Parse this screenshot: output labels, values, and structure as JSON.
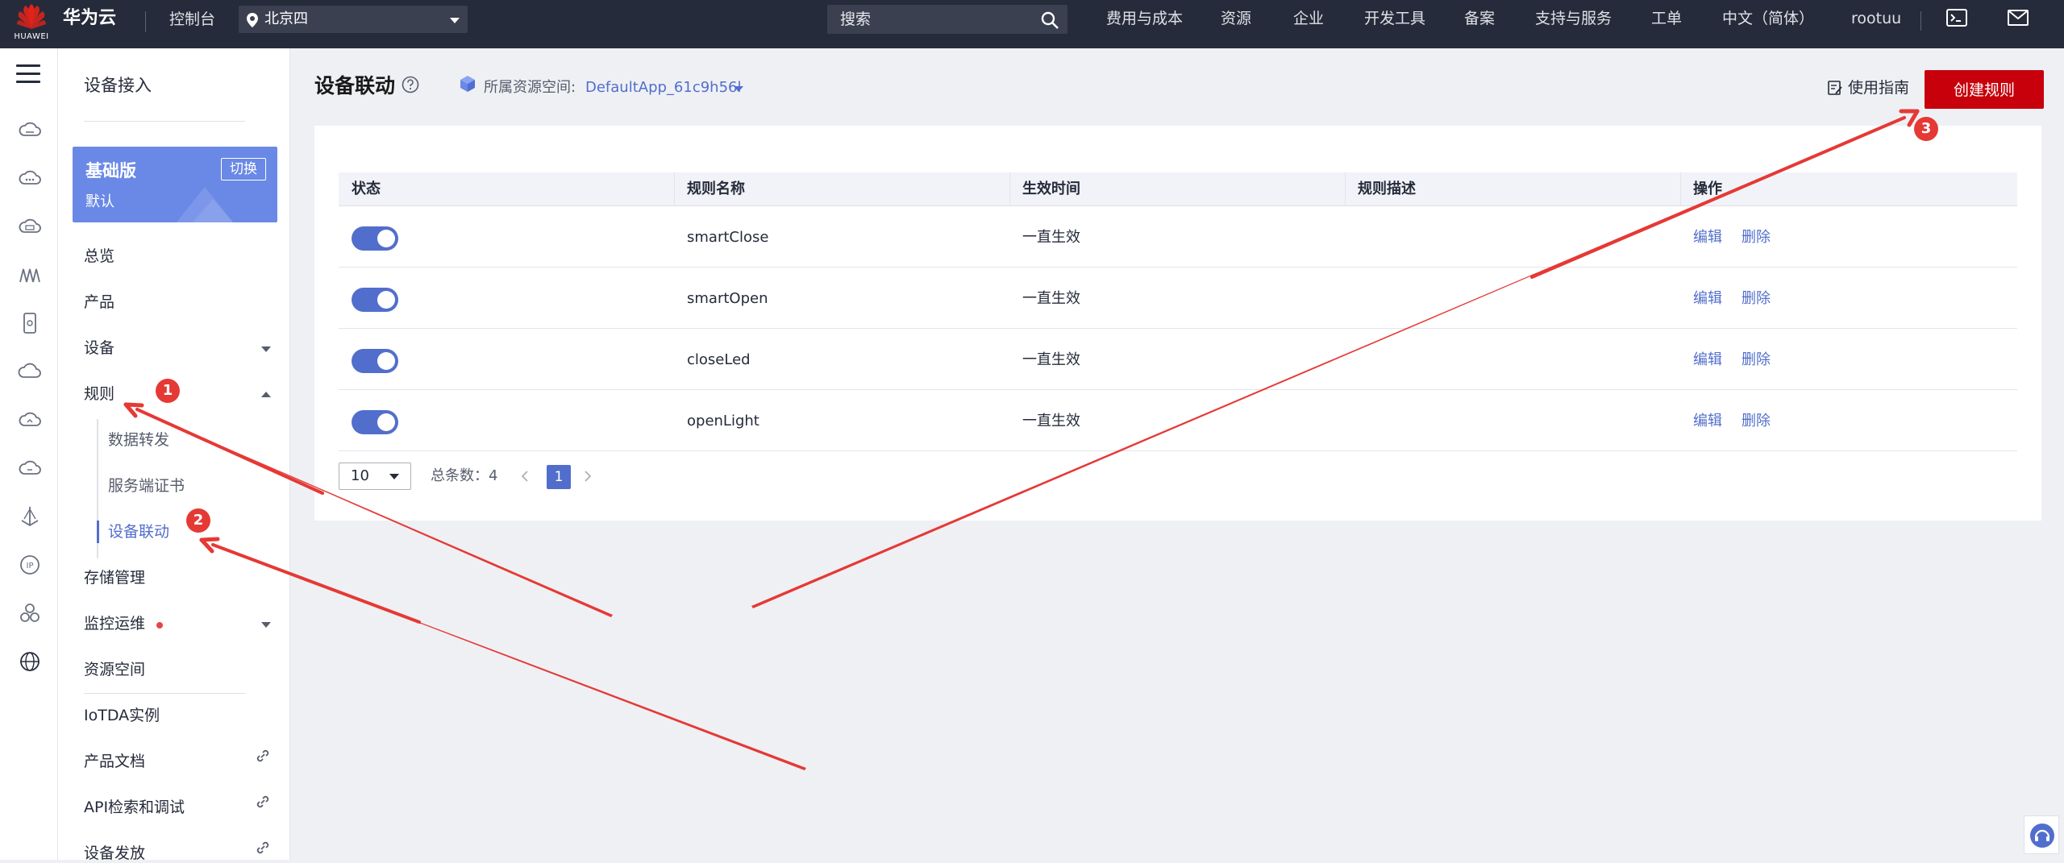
{
  "header": {
    "logo_text": "HUAWEI",
    "brand": "华为云",
    "console": "控制台",
    "region": "北京四",
    "search_placeholder": "搜索",
    "nav": [
      "费用与成本",
      "资源",
      "企业",
      "开发工具",
      "备案",
      "支持与服务",
      "工单",
      "中文（简体）",
      "rootuu"
    ]
  },
  "sidebar": {
    "title": "设备接入",
    "edition": {
      "name": "基础版",
      "sub": "默认",
      "switch": "切换"
    },
    "items": {
      "overview": "总览",
      "product": "产品",
      "device": "设备",
      "rules": "规则",
      "data_forward": "数据转发",
      "server_cert": "服务端证书",
      "device_linkage": "设备联动",
      "storage": "存储管理",
      "monitor": "监控运维",
      "resource_space": "资源空间",
      "iotda_instance": "IoTDA实例",
      "product_docs": "产品文档",
      "api_explorer": "API检索和调试",
      "device_provision": "设备发放"
    }
  },
  "main": {
    "title": "设备联动",
    "space_label": "所属资源空间:",
    "space_value": "DefaultApp_61c9h56l",
    "guide": "使用指南",
    "create_button": "创建规则",
    "table": {
      "headers": [
        "状态",
        "规则名称",
        "生效时间",
        "规则描述",
        "操作"
      ],
      "rows": [
        {
          "enabled": true,
          "name": "smartClose",
          "time": "一直生效",
          "desc": "",
          "edit": "编辑",
          "delete": "删除"
        },
        {
          "enabled": true,
          "name": "smartOpen",
          "time": "一直生效",
          "desc": "",
          "edit": "编辑",
          "delete": "删除"
        },
        {
          "enabled": true,
          "name": "closeLed",
          "time": "一直生效",
          "desc": "",
          "edit": "编辑",
          "delete": "删除"
        },
        {
          "enabled": true,
          "name": "openLight",
          "time": "一直生效",
          "desc": "",
          "edit": "编辑",
          "delete": "删除"
        }
      ]
    },
    "pagination": {
      "page_size": "10",
      "total": "总条数：4",
      "current": "1"
    }
  },
  "annotations": [
    "1",
    "2",
    "3"
  ],
  "colors": {
    "accent": "#526ecc",
    "primary_button": "#c7000b",
    "topbar": "#252b3a",
    "annotation": "#e53935"
  }
}
